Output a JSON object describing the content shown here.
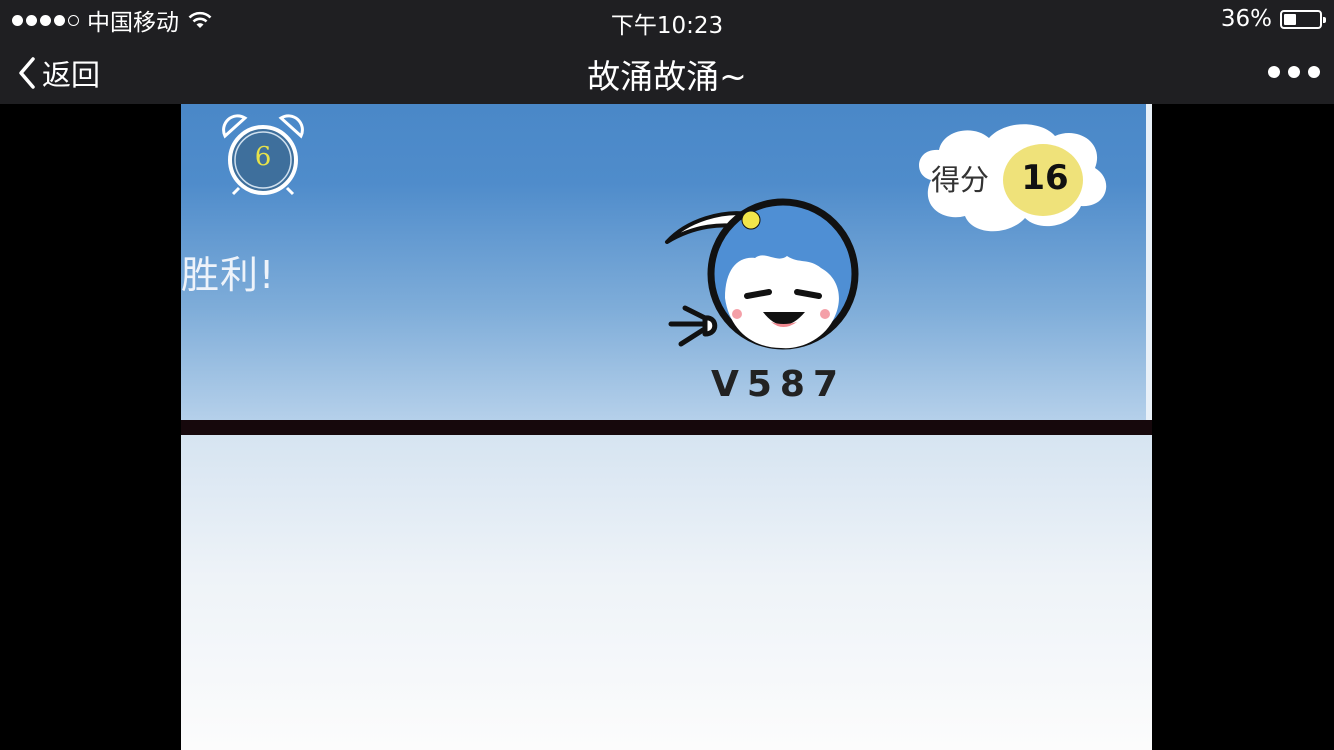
{
  "status_bar": {
    "carrier": "中国移动",
    "time": "下午10:23",
    "battery_percent": "36%",
    "battery_level": 0.36,
    "signal_bars": 4,
    "signal_max": 5
  },
  "nav_bar": {
    "back_label": "返回",
    "title": "故涌故涌~"
  },
  "game": {
    "timer": "6",
    "result_text": "胜利!",
    "score_label": "得分",
    "score_value": "16",
    "character_name": "V587",
    "colors": {
      "sky_top": "#4a88c8",
      "sky_bottom": "#b5d0ea",
      "score_badge": "#efe27a",
      "timer_digit": "#e6e24a"
    }
  }
}
